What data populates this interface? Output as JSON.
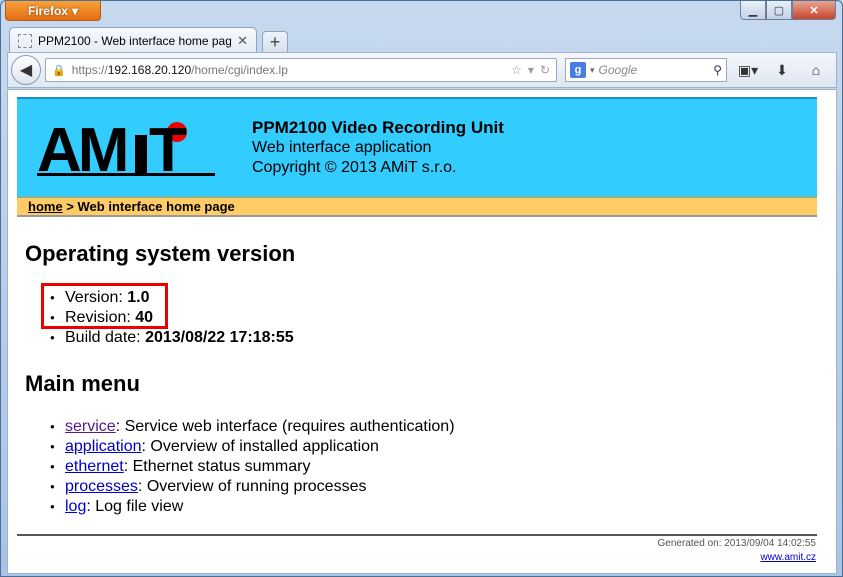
{
  "browser": {
    "app_button": "Firefox",
    "tab_title": "PPM2100 - Web interface home page",
    "url_host": "192.168.20.120",
    "url_prefix": "https://",
    "url_path": "/home/cgi/index.lp",
    "search_placeholder": "Google",
    "icons": [
      "back-icon",
      "lock-icon",
      "star-icon",
      "reload-icon",
      "google-icon",
      "search-icon",
      "bookmarks-icon",
      "download-icon",
      "home-icon"
    ]
  },
  "banner": {
    "logo_text": "AMiT",
    "title": "PPM2100 Video Recording Unit",
    "subtitle": "Web interface application",
    "copyright": "Copyright © 2013 AMiT s.r.o.",
    "color": "#33ccff"
  },
  "breadcrumb": {
    "home": "home",
    "separator": ">",
    "current": "Web interface home page"
  },
  "os": {
    "heading": "Operating system version",
    "items": [
      {
        "label": "Version:",
        "value": "1.0"
      },
      {
        "label": "Revision:",
        "value": "40"
      },
      {
        "label": "Build date:",
        "value": "2013/08/22 17:18:55"
      }
    ]
  },
  "menu": {
    "heading": "Main menu",
    "items": [
      {
        "link": "service",
        "desc": ": Service web interface (requires authentication)"
      },
      {
        "link": "application",
        "desc": ": Overview of installed application"
      },
      {
        "link": "ethernet",
        "desc": ": Ethernet status summary"
      },
      {
        "link": "processes",
        "desc": ": Overview of running processes"
      },
      {
        "link": "log",
        "desc": ": Log file view"
      }
    ]
  },
  "footer": {
    "generated": "Generated on: 2013/09/04 14:02:55",
    "site": "www.amit.cz"
  }
}
